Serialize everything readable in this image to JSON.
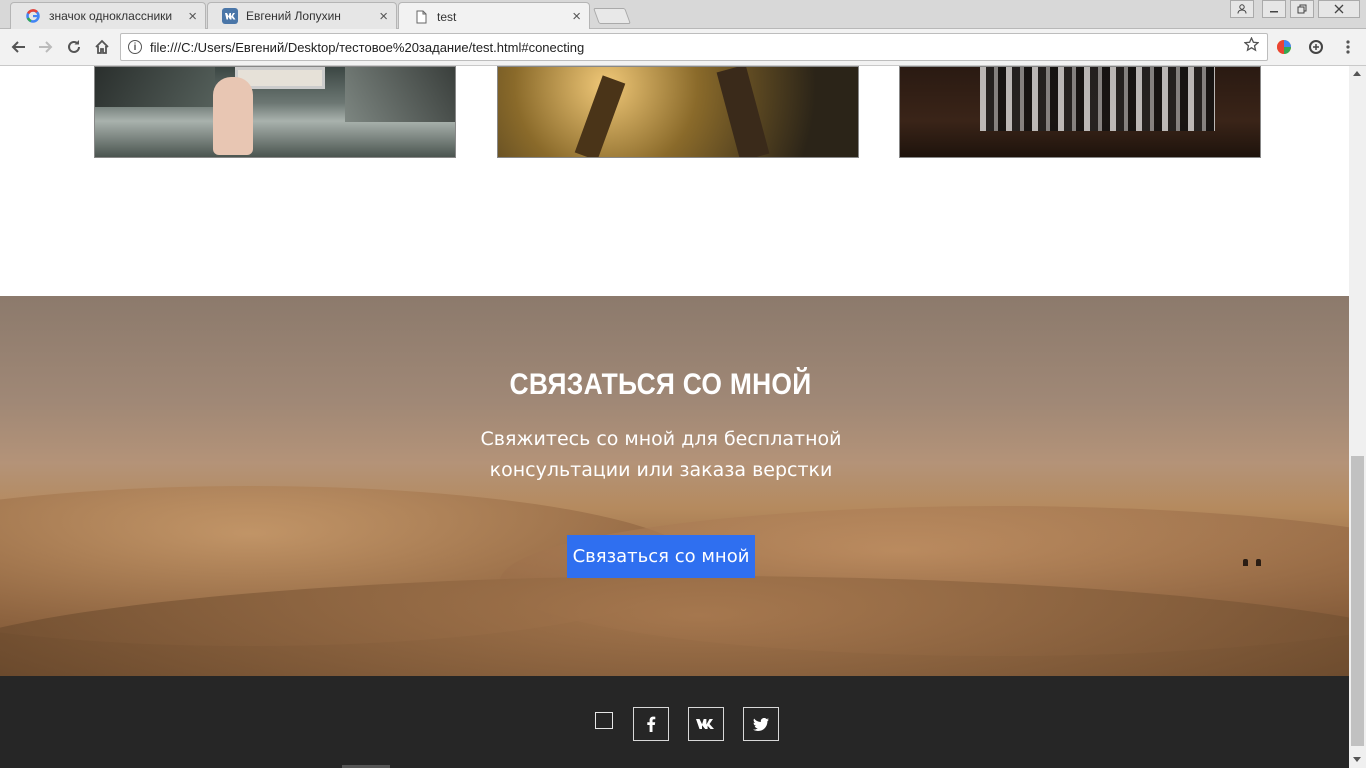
{
  "browser": {
    "tabs": [
      {
        "title": "значок одноклассники",
        "icon": "google-icon",
        "active": false
      },
      {
        "title": "Евгений Лопухин",
        "icon": "vk-icon",
        "active": false
      },
      {
        "title": "test",
        "icon": "page-icon",
        "active": true
      }
    ],
    "tab_close_glyph": "×",
    "url": "file:///C:/Users/Евгений/Desktop/тестовое%20задание/test.html#conecting"
  },
  "contact": {
    "title": "СВЯЗАТЬСЯ СО МНОЙ",
    "subtitle": "Свяжитесь со мной для бесплатной консультации или заказа верстки",
    "button_label": "Связаться со мной",
    "button_color": "#2f6ff0"
  },
  "footer": {
    "background": "#262626",
    "social_icons": [
      "facebook-icon",
      "vk-icon",
      "twitter-icon"
    ]
  }
}
